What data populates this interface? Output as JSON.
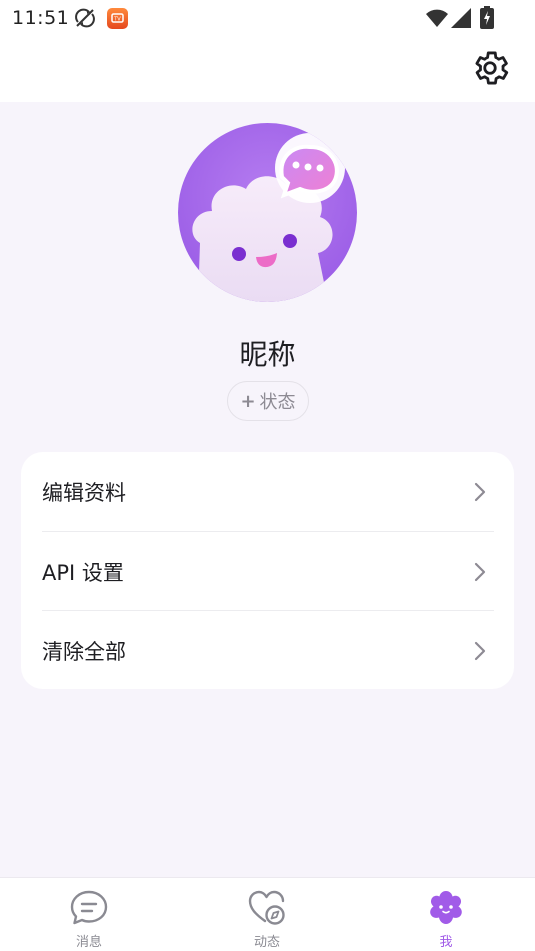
{
  "status_bar": {
    "time": "11:51",
    "icons": [
      "sync-off-icon",
      "app-tv-icon",
      "wifi-icon",
      "signal-icon",
      "battery-charging-icon"
    ]
  },
  "header": {
    "settings_icon": "gear-icon"
  },
  "profile": {
    "avatar_icon": "cloud-mascot-chat-icon",
    "nickname": "昵称",
    "status_button": {
      "plus": "+",
      "label": "状态"
    }
  },
  "menu": {
    "items": [
      {
        "label": "编辑资料",
        "icon": "chevron-right-icon"
      },
      {
        "label": "API 设置",
        "icon": "chevron-right-icon"
      },
      {
        "label": "清除全部",
        "icon": "chevron-right-icon"
      }
    ]
  },
  "tabbar": {
    "active_color": "#a15be8",
    "tabs": [
      {
        "label": "消息",
        "icon": "chat-bubble-icon"
      },
      {
        "label": "动态",
        "icon": "heart-compass-icon"
      },
      {
        "label": "我",
        "icon": "flower-mascot-icon"
      }
    ]
  },
  "colors": {
    "accent": "#a15be8",
    "background": "#f7f4fb"
  }
}
